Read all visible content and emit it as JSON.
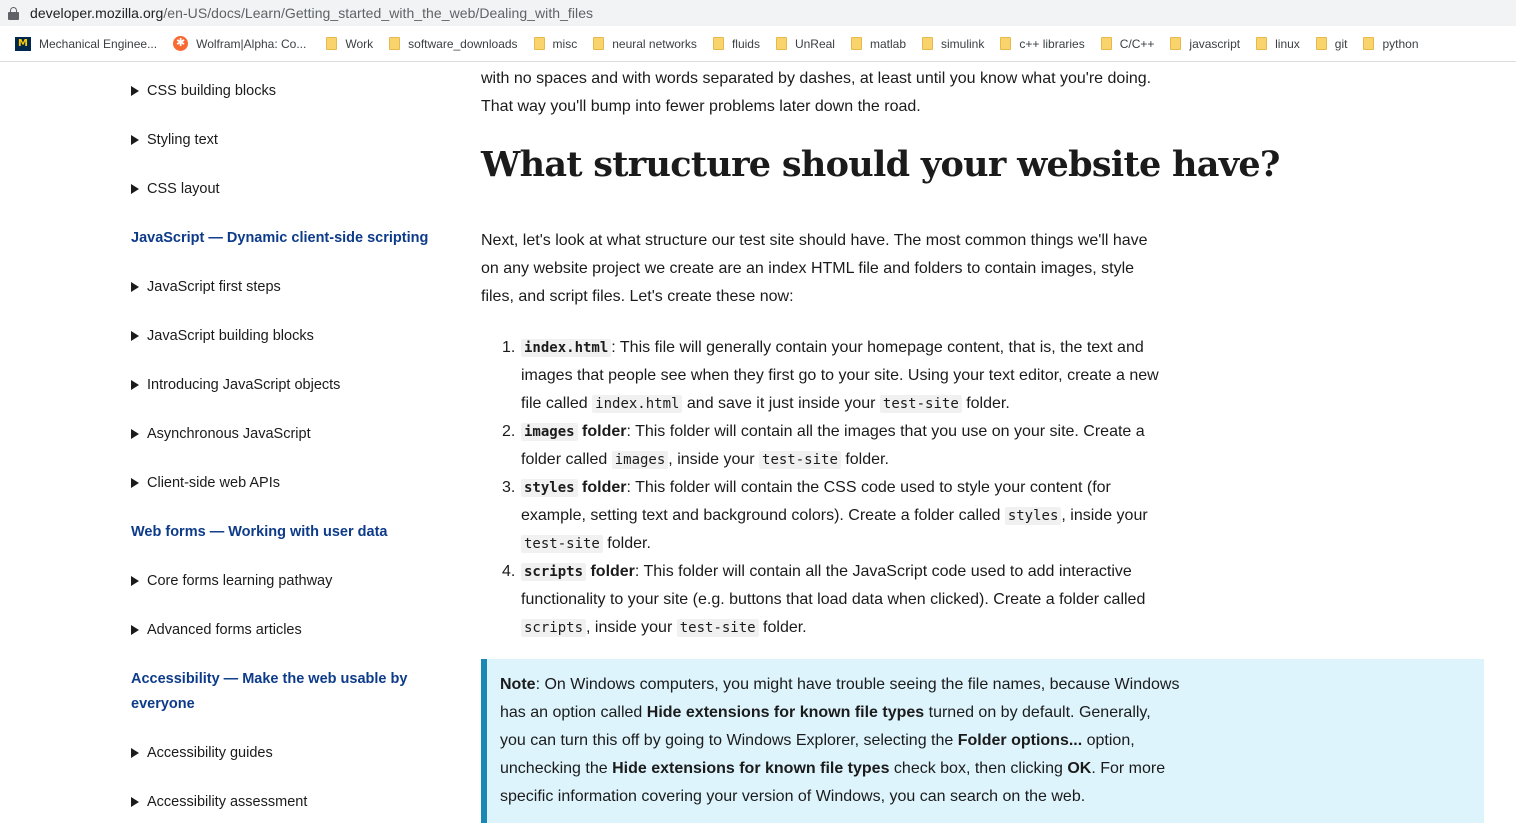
{
  "browser": {
    "url_host": "developer.mozilla.org",
    "url_path": "/en-US/docs/Learn/Getting_started_with_the_web/Dealing_with_files",
    "bookmarks": [
      {
        "label": "Mechanical Enginee...",
        "icon": "umich-icon"
      },
      {
        "label": "Wolfram|Alpha: Co...",
        "icon": "wolfram-icon"
      },
      {
        "label": "Work",
        "icon": "folder-icon"
      },
      {
        "label": "software_downloads",
        "icon": "folder-icon"
      },
      {
        "label": "misc",
        "icon": "folder-icon"
      },
      {
        "label": "neural networks",
        "icon": "folder-icon"
      },
      {
        "label": "fluids",
        "icon": "folder-icon"
      },
      {
        "label": "UnReal",
        "icon": "folder-icon"
      },
      {
        "label": "matlab",
        "icon": "folder-icon"
      },
      {
        "label": "simulink",
        "icon": "folder-icon"
      },
      {
        "label": "c++ libraries",
        "icon": "folder-icon"
      },
      {
        "label": "C/C++",
        "icon": "folder-icon"
      },
      {
        "label": "javascript",
        "icon": "folder-icon"
      },
      {
        "label": "linux",
        "icon": "folder-icon"
      },
      {
        "label": "git",
        "icon": "folder-icon"
      },
      {
        "label": "python",
        "icon": "folder-icon"
      }
    ]
  },
  "sidebar": {
    "items": [
      {
        "type": "item",
        "label": "CSS building blocks"
      },
      {
        "type": "item",
        "label": "Styling text"
      },
      {
        "type": "item",
        "label": "CSS layout"
      },
      {
        "type": "section",
        "label": "JavaScript — Dynamic client-side scripting"
      },
      {
        "type": "item",
        "label": "JavaScript first steps"
      },
      {
        "type": "item",
        "label": "JavaScript building blocks"
      },
      {
        "type": "item",
        "label": "Introducing JavaScript objects"
      },
      {
        "type": "item",
        "label": "Asynchronous JavaScript"
      },
      {
        "type": "item",
        "label": "Client-side web APIs"
      },
      {
        "type": "section",
        "label": "Web forms — Working with user data"
      },
      {
        "type": "item",
        "label": "Core forms learning pathway"
      },
      {
        "type": "item",
        "label": "Advanced forms articles"
      },
      {
        "type": "section",
        "label": "Accessibility — Make the web usable by everyone"
      },
      {
        "type": "item",
        "label": "Accessibility guides"
      },
      {
        "type": "item",
        "label": "Accessibility assessment"
      }
    ]
  },
  "content": {
    "intro_line1": "with no spaces and with words separated by dashes, at least until you know what you're doing.",
    "intro_line2": "That way you'll bump into fewer problems later down the road.",
    "heading": "What structure should your website have?",
    "para": "Next, let's look at what structure our test site should have. The most common things we'll have on any website project we create are an index HTML file and folders to contain images, style files, and script files. Let's create these now:",
    "list": [
      {
        "num": "1.",
        "code": "index.html",
        "bold_suffix": "",
        "text_a": ": This file will generally contain your homepage content, that is, the text and images that people see when they first go to your site. Using your text editor, create a new file called ",
        "code_a": "index.html",
        "text_b": " and save it just inside your ",
        "code_b": "test-site",
        "text_c": " folder."
      },
      {
        "num": "2.",
        "code": "images",
        "bold_suffix": " folder",
        "text_a": ": This folder will contain all the images that you use on your site. Create a folder called ",
        "code_a": "images",
        "text_b": ", inside your ",
        "code_b": "test-site",
        "text_c": " folder."
      },
      {
        "num": "3.",
        "code": "styles",
        "bold_suffix": " folder",
        "text_a": ": This folder will contain the CSS code used to style your content (for example, setting text and background colors). Create a folder called ",
        "code_a": "styles",
        "text_b": ", inside your ",
        "code_b": "test-site",
        "text_c": " folder."
      },
      {
        "num": "4.",
        "code": "scripts",
        "bold_suffix": " folder",
        "text_a": ": This folder will contain all the JavaScript code used to add interactive functionality to your site (e.g. buttons that load data when clicked). Create a folder called ",
        "code_a": "scripts",
        "text_b": ", inside your ",
        "code_b": "test-site",
        "text_c": " folder."
      }
    ],
    "note": {
      "label": "Note",
      "t1": ": On Windows computers, you might have trouble seeing the file names, because Windows has an option called ",
      "b1": "Hide extensions for known file types",
      "t2": " turned on by default. Generally, you can turn this off by going to Windows Explorer, selecting the ",
      "b2": "Folder options...",
      "t3": " option, unchecking the ",
      "b3": "Hide extensions for known file types",
      "t4": " check box, then clicking ",
      "b4": "OK",
      "t5": ". For more specific information covering your version of Windows, you can search on the web."
    }
  }
}
